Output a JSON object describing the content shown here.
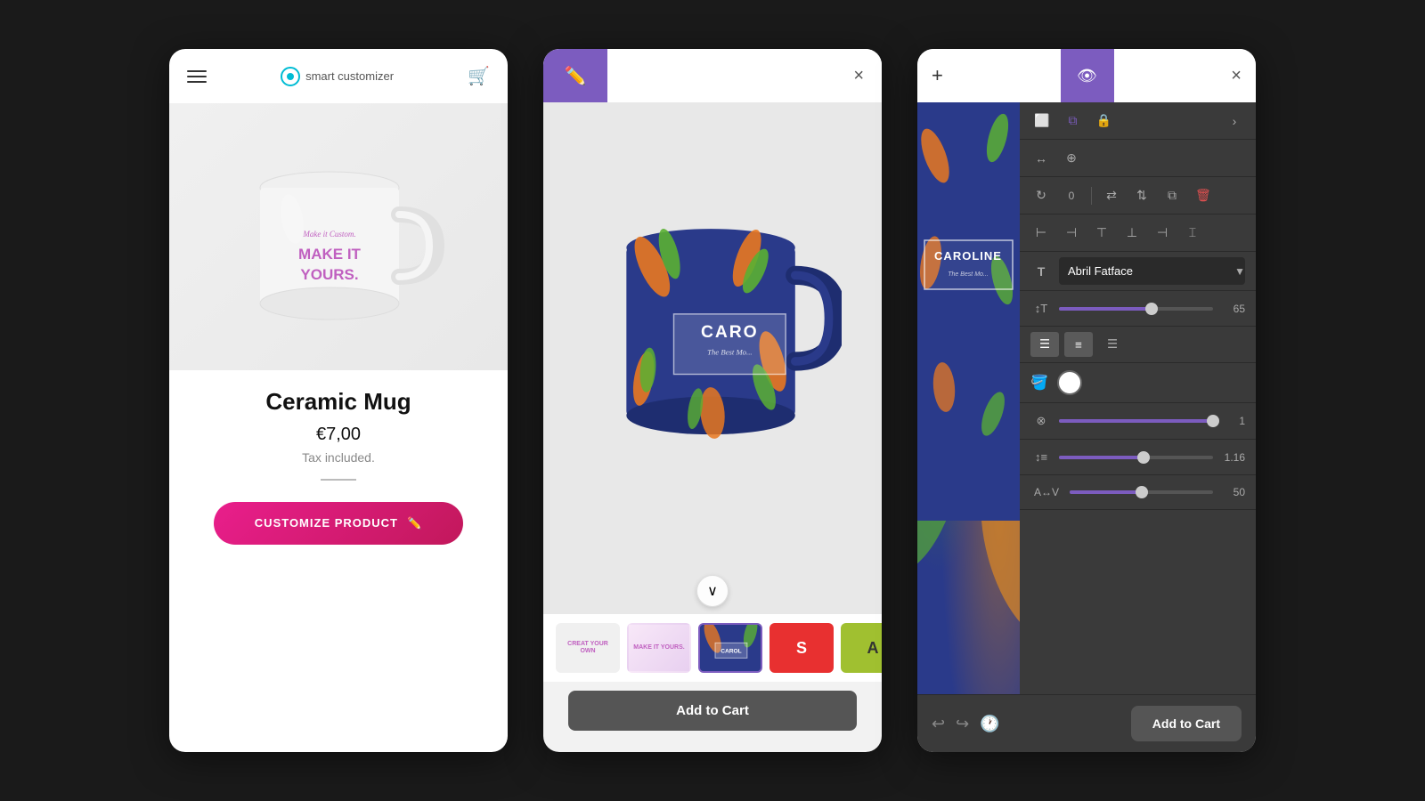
{
  "card1": {
    "header": {
      "logo_text": "smart customizer",
      "menu_label": "menu",
      "cart_label": "cart"
    },
    "product": {
      "name": "Ceramic Mug",
      "price": "€7,00",
      "tax": "Tax included.",
      "customize_btn": "CUSTOMIZE PRODUCT",
      "mug_tagline1": "Make it Custom.",
      "mug_tagline2": "MAKE IT YOURS."
    }
  },
  "card2": {
    "header": {
      "close_label": "×",
      "edit_tab_label": "edit"
    },
    "thumbnails": [
      {
        "id": "thumb1",
        "label": "CREAT YOUR OWN",
        "active": false
      },
      {
        "id": "thumb2",
        "label": "MAKE IT YOURS.",
        "active": false
      },
      {
        "id": "thumb3",
        "label": "CAROLINE",
        "active": true
      },
      {
        "id": "thumb4",
        "label": "S",
        "active": false
      },
      {
        "id": "thumb5",
        "label": "A",
        "active": false
      },
      {
        "id": "thumb6",
        "label": "",
        "active": false
      }
    ],
    "add_to_cart": "Add to Cart"
  },
  "card3": {
    "header": {
      "plus_label": "+",
      "close_label": "×",
      "eye_tab_label": "preview"
    },
    "panel": {
      "font_name": "Abril Fatface",
      "font_size": 65,
      "size_pct": 60,
      "opacity_value": 1,
      "opacity_pct": 100,
      "line_height_value": "1.16",
      "line_height_pct": 55,
      "letter_spacing_value": 50
    },
    "add_to_cart": "Add to Cart",
    "undo_label": "undo",
    "redo_label": "redo",
    "history_label": "history"
  }
}
